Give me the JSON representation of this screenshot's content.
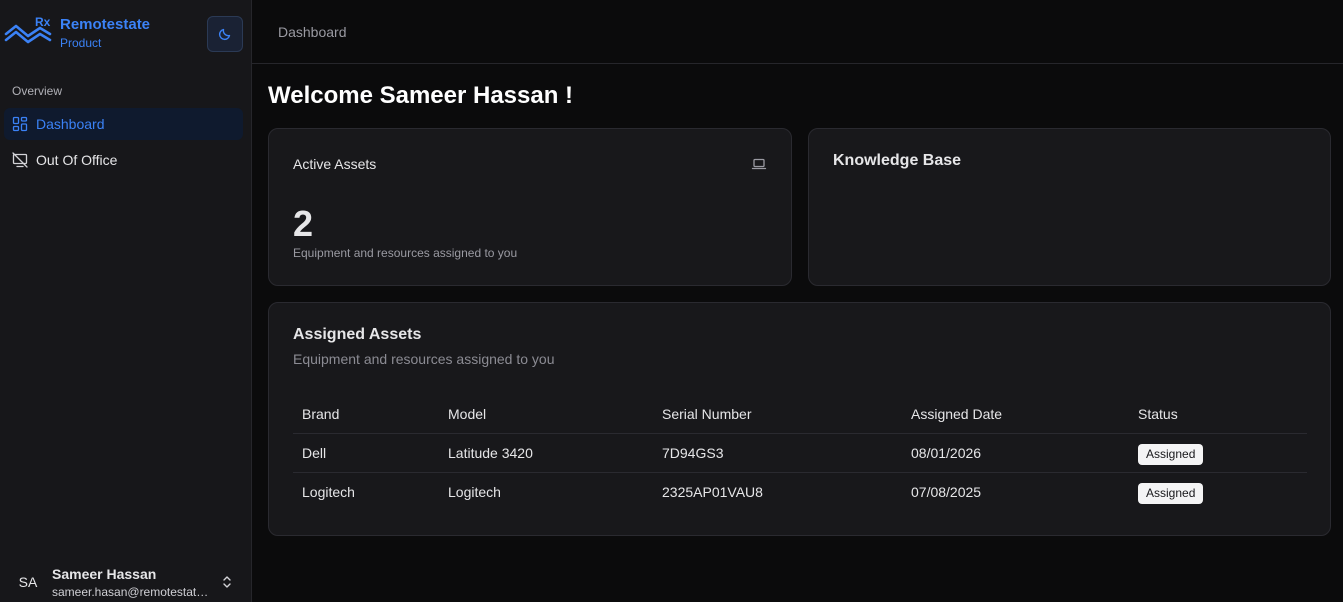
{
  "brand": {
    "logo_text": "Rx",
    "name": "Remotestate",
    "subtitle": "Product"
  },
  "sidebar": {
    "section_label": "Overview",
    "items": [
      {
        "label": "Dashboard",
        "icon": "dashboard-icon",
        "active": true
      },
      {
        "label": "Out Of Office",
        "icon": "monitor-off-icon",
        "active": false
      }
    ]
  },
  "user": {
    "initials": "SA",
    "name": "Sameer Hassan",
    "email": "sameer.hasan@remotestate.com"
  },
  "header": {
    "breadcrumb": "Dashboard"
  },
  "main": {
    "welcome": "Welcome Sameer Hassan !",
    "active_assets": {
      "title": "Active Assets",
      "count": "2",
      "description": "Equipment and resources assigned to you",
      "icon": "laptop-icon"
    },
    "knowledge_base": {
      "title": "Knowledge Base"
    },
    "assigned_assets": {
      "title": "Assigned Assets",
      "subtitle": "Equipment and resources assigned to you",
      "columns": [
        "Brand",
        "Model",
        "Serial Number",
        "Assigned Date",
        "Status"
      ],
      "rows": [
        [
          "Dell",
          "Latitude 3420",
          "7D94GS3",
          "08/01/2026",
          "Assigned"
        ],
        [
          "Logitech",
          "Logitech",
          "2325AP01VAU8",
          "07/08/2025",
          "Assigned"
        ]
      ]
    }
  },
  "colors": {
    "accent": "#3b82f6",
    "background": "#0b0b0c",
    "card": "#18181b"
  }
}
